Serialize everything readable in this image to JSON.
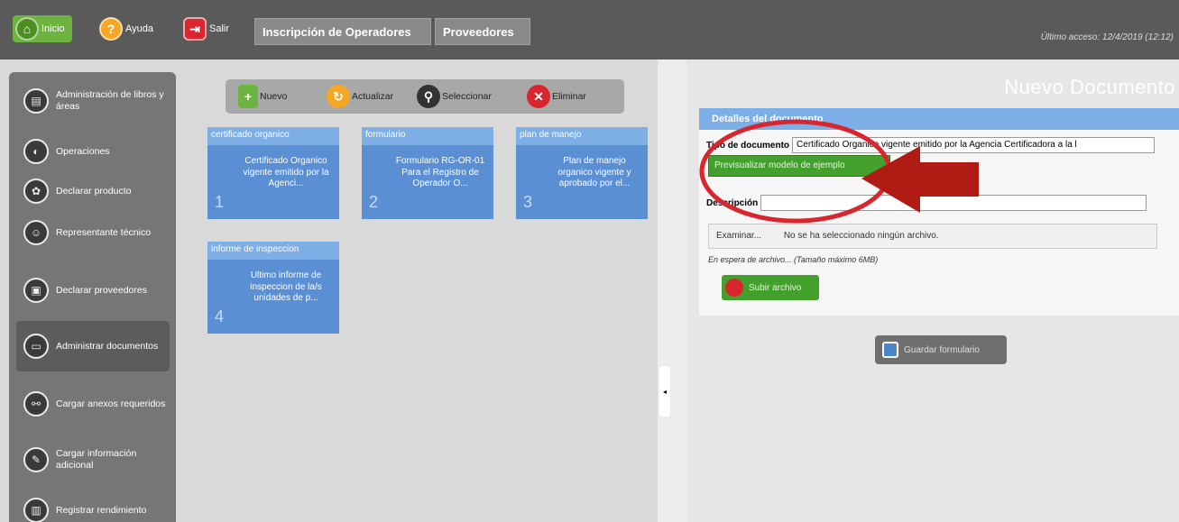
{
  "topbar": {
    "inicio": "Inicio",
    "ayuda": "Ayuda",
    "salir": "Salir",
    "tab_ops": "Inscripción de Operadores",
    "tab_prov": "Proveedores",
    "last_access": "Último acceso: 12/4/2019 (12:12)"
  },
  "sidebar": {
    "items": [
      {
        "label": "Administración de libros y áreas",
        "icon": "books-icon"
      },
      {
        "label": "Operaciones",
        "icon": "operations-icon"
      },
      {
        "label": "Declarar producto",
        "icon": "product-icon"
      },
      {
        "label": "Representante técnico",
        "icon": "people-icon"
      },
      {
        "label": "Declarar proveedores",
        "icon": "supplier-icon"
      },
      {
        "label": "Administrar documentos",
        "icon": "document-icon"
      },
      {
        "label": "Cargar anexos requeridos",
        "icon": "attach-icon"
      },
      {
        "label": "Cargar información adicional",
        "icon": "info-icon"
      },
      {
        "label": "Registrar rendimiento",
        "icon": "chart-icon"
      }
    ]
  },
  "toolbar": {
    "nuevo": "Nuevo",
    "actualizar": "Actualizar",
    "seleccionar": "Seleccionar",
    "eliminar": "Eliminar"
  },
  "cards": [
    {
      "head": "certificado organico",
      "num": "1",
      "text": "Certificado Organico vigente emitido por la Agenci..."
    },
    {
      "head": "formulario",
      "num": "2",
      "text": "Formulario RG-OR-01 Para el Registro de Operador O..."
    },
    {
      "head": "plan de manejo",
      "num": "3",
      "text": "Plan de manejo organico vigente y aprobado por el..."
    },
    {
      "head": "informe de inspeccion",
      "num": "4",
      "text": "Ultimo informe de inspeccion de la/s unidades de p..."
    }
  ],
  "right": {
    "title": "Nuevo Documento",
    "details_head": "Detalles del documento",
    "tipo_label": "Tipo de documento",
    "tipo_value": "Certificado Organico vigente emitido por la Agencia Certificadora a la l",
    "prev_button": "Previsualizar modelo de ejemplo",
    "desc_label": "Descripción",
    "exam": "Examinar...",
    "no_file": "No se ha seleccionado ningún archivo.",
    "file_hint": "En espera de archivo... (Tamaño máximo 6MB)",
    "subir": "Subir archivo",
    "guardar": "Guardar formulario"
  },
  "colors": {
    "annotation_circle": "#d9262e",
    "annotation_arrow": "#b01c14"
  }
}
